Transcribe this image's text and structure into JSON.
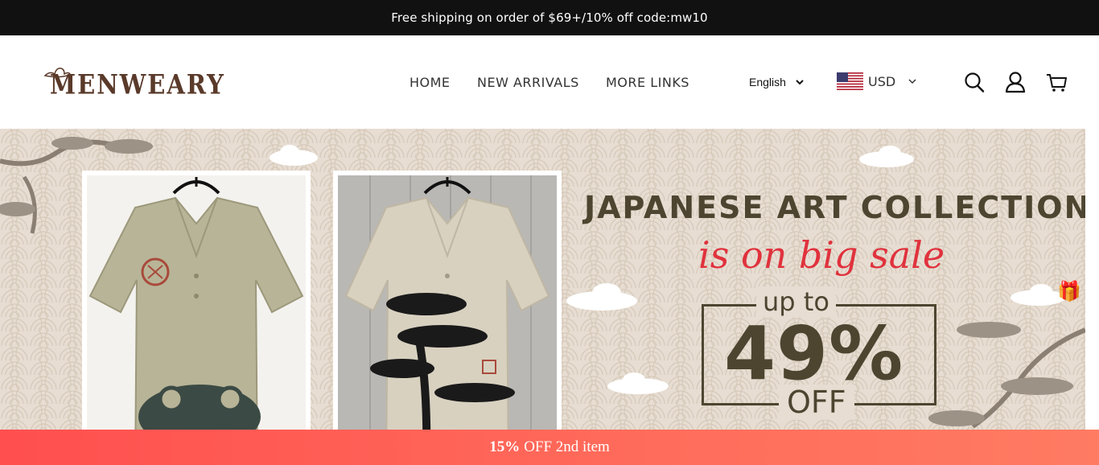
{
  "announcement": {
    "text": "Free shipping on order of $69+/10% off code:mw10"
  },
  "header": {
    "logo_text": "MENWEARY",
    "nav": [
      {
        "label": "HOME"
      },
      {
        "label": "NEW ARRIVALS"
      },
      {
        "label": "MORE LINKS"
      }
    ],
    "language": {
      "selected": "English"
    },
    "currency": {
      "selected": "USD",
      "flag": "us-flag-icon"
    },
    "icons": [
      "search-icon",
      "account-icon",
      "cart-icon"
    ]
  },
  "hero": {
    "title": "JAPANESE ART COLLECTION",
    "subtitle": "is on big sale",
    "up_to": "up to",
    "percent": "49%",
    "off": "OFF",
    "background_color": "#e7ddd2",
    "text_color": "#4d4530",
    "accent_color": "#e0323d"
  },
  "promo_bar": {
    "bold": "15%",
    "text": "OFF 2nd item"
  }
}
